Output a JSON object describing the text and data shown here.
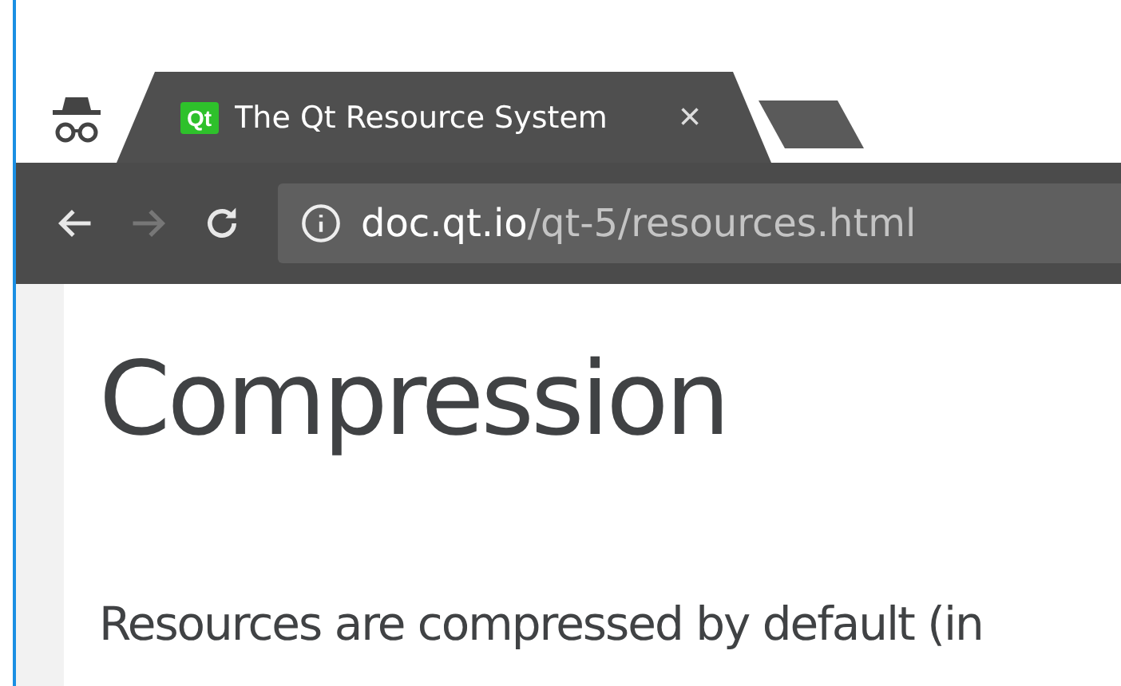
{
  "browser": {
    "incognito": true
  },
  "tabs": [
    {
      "favicon": "Qt",
      "title": "The Qt Resource System",
      "close": "×",
      "selected": true
    }
  ],
  "toolbar": {
    "back": {
      "disabled": false
    },
    "forward": {
      "disabled": true
    },
    "address": {
      "host": "doc.qt.io",
      "path": "/qt-5/resources.html"
    }
  },
  "page": {
    "heading": "Compression",
    "paragraph": "Resources are compressed by default (in"
  }
}
